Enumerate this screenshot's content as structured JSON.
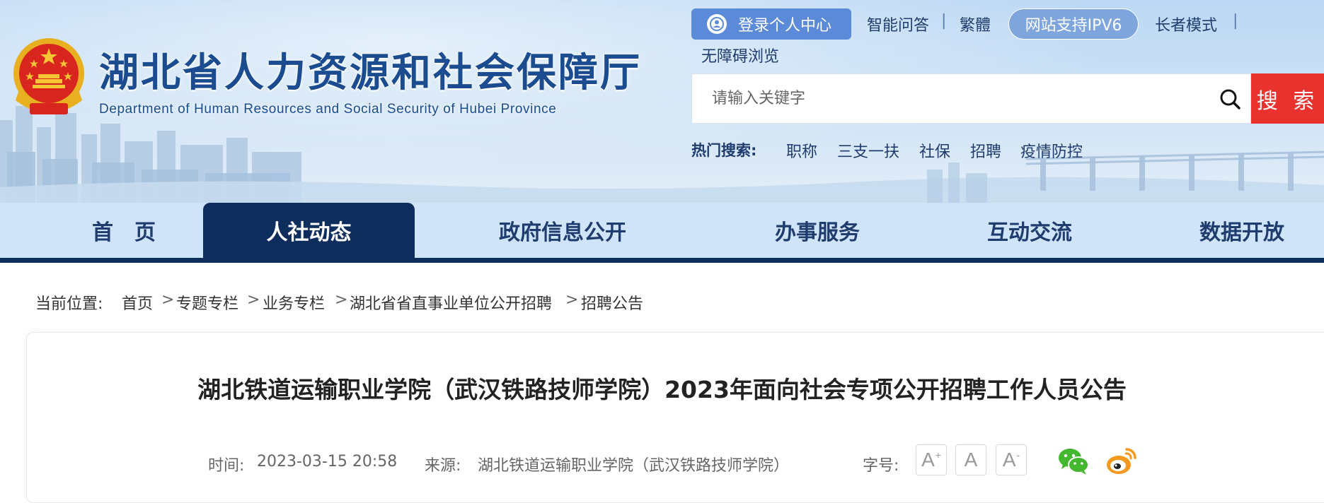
{
  "header": {
    "site_title_cn": "湖北省人力资源和社会保障厅",
    "site_title_en": "Department of Human Resources and Social Security of Hubei Province",
    "login_label": "登录个人中心",
    "links": {
      "qa": "智能问答",
      "traditional": "繁體",
      "ipv6": "网站支持IPV6",
      "elder": "长者模式",
      "accessibility": "无障碍浏览"
    },
    "separator": "|",
    "search_placeholder": "请输入关键字",
    "search_button": "搜 索",
    "hot_label": "热门搜索:",
    "hot_items": [
      "职称",
      "三支一扶",
      "社保",
      "招聘",
      "疫情防控"
    ]
  },
  "nav": {
    "items": [
      "首　页",
      "人社动态",
      "政府信息公开",
      "办事服务",
      "互动交流",
      "数据开放"
    ],
    "active_index": 1
  },
  "breadcrumb": {
    "label": "当前位置:",
    "separator": ">",
    "items": [
      "首页",
      "专题专栏",
      "业务专栏",
      "湖北省省直事业单位公开招聘",
      "招聘公告"
    ]
  },
  "article": {
    "title": "湖北铁道运输职业学院（武汉铁路技师学院）2023年面向社会专项公开招聘工作人员公告",
    "time_label": "时间:",
    "time_value": "2023-03-15 20:58",
    "source_label": "来源:",
    "source_value": "湖北铁道运输职业学院（武汉铁路技师学院）",
    "font_size_label": "字号:",
    "font_buttons": {
      "letter": "A",
      "plus": "+",
      "minus": "-"
    }
  },
  "colors": {
    "brand_blue": "#1a4c8f",
    "nav_dark": "#0d2d5c",
    "search_red": "#e8322d",
    "login_blue": "#5b8bd8",
    "wechat_green": "#43b72f",
    "weibo_orange": "#f39a1e"
  },
  "icons": {
    "emblem": "national-emblem-icon",
    "login": "user-icon",
    "search": "search-icon",
    "wechat": "wechat-icon",
    "weibo": "weibo-icon"
  }
}
